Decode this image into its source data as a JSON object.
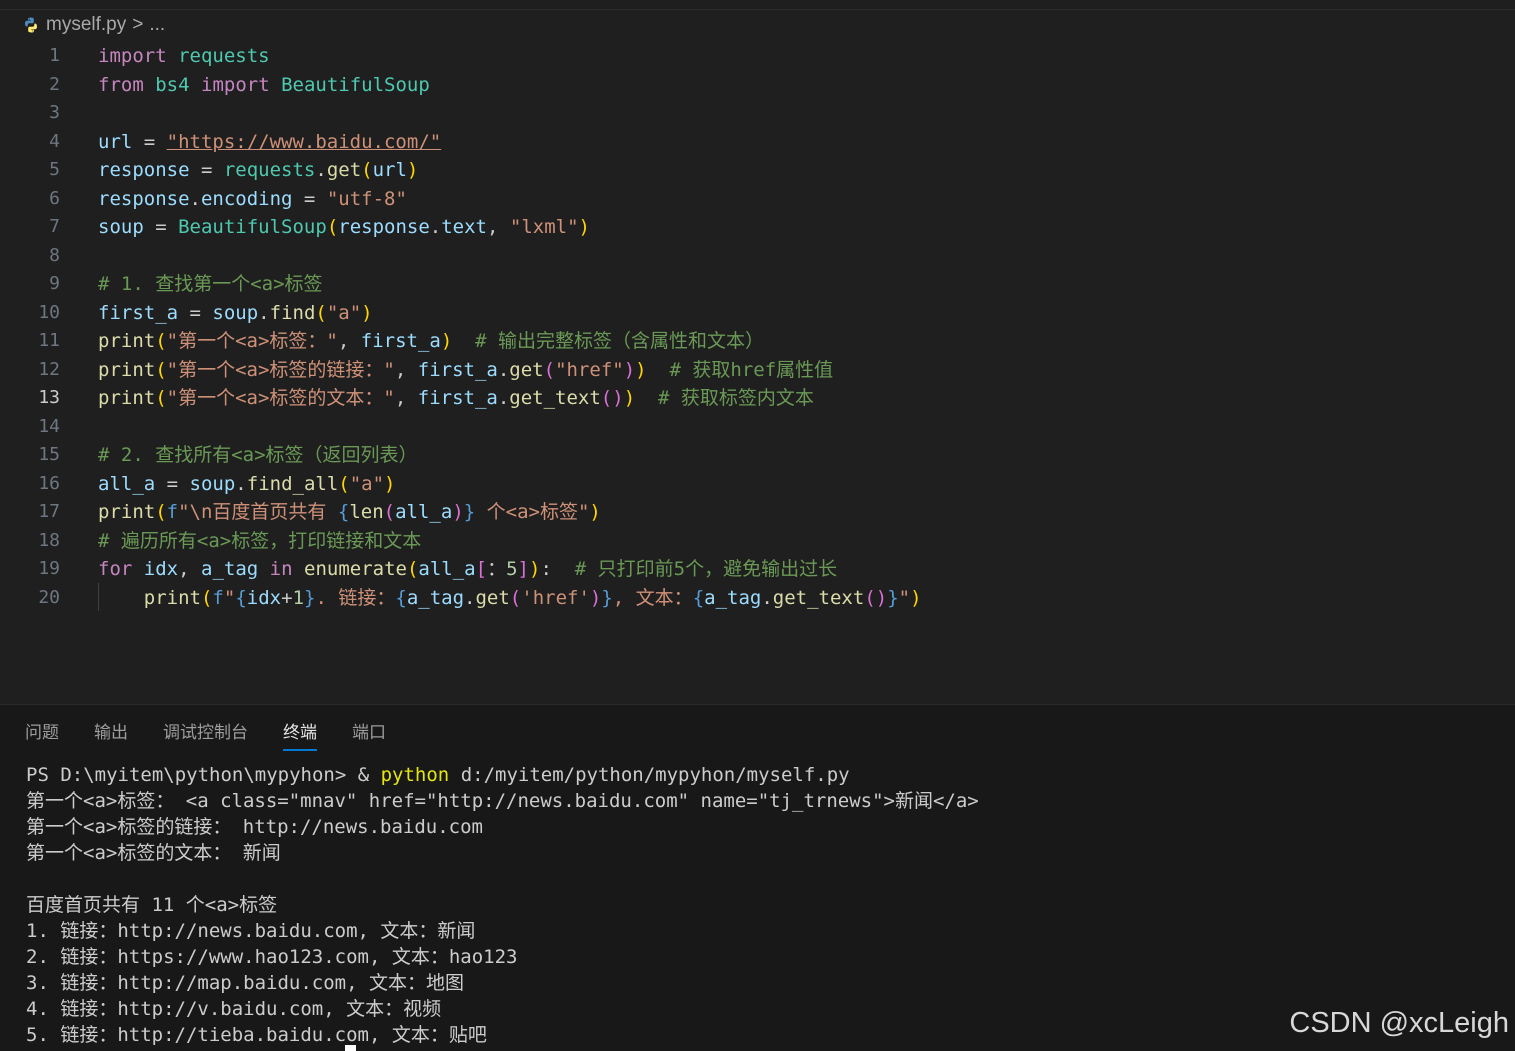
{
  "breadcrumb": {
    "file": "myself.py",
    "separator": ">",
    "more": "..."
  },
  "code_lines": [
    {
      "n": "1",
      "tokens": [
        [
          "k",
          "import"
        ],
        [
          "",
          "",
          " "
        ],
        [
          "m",
          "requests"
        ]
      ]
    },
    {
      "n": "2",
      "tokens": [
        [
          "k",
          "from"
        ],
        [
          "",
          " "
        ],
        [
          "m",
          "bs4"
        ],
        [
          "",
          " "
        ],
        [
          "k",
          "import"
        ],
        [
          "",
          " "
        ],
        [
          "m",
          "BeautifulSoup"
        ]
      ]
    },
    {
      "n": "3",
      "tokens": []
    },
    {
      "n": "4",
      "tokens": [
        [
          "v",
          "url"
        ],
        [
          "",
          " = "
        ],
        [
          "s u",
          "\"https://www.baidu.com/\""
        ]
      ]
    },
    {
      "n": "5",
      "tokens": [
        [
          "v",
          "response"
        ],
        [
          "",
          " = "
        ],
        [
          "m",
          "requests"
        ],
        [
          "",
          "."
        ],
        [
          "f",
          "get"
        ],
        [
          "p",
          "("
        ],
        [
          "v",
          "url"
        ],
        [
          "p",
          ")"
        ]
      ]
    },
    {
      "n": "6",
      "tokens": [
        [
          "v",
          "response"
        ],
        [
          "",
          "."
        ],
        [
          "v",
          "encoding"
        ],
        [
          "",
          " = "
        ],
        [
          "s",
          "\"utf-8\""
        ]
      ]
    },
    {
      "n": "7",
      "tokens": [
        [
          "v",
          "soup"
        ],
        [
          "",
          " = "
        ],
        [
          "m",
          "BeautifulSoup"
        ],
        [
          "p",
          "("
        ],
        [
          "v",
          "response"
        ],
        [
          "",
          "."
        ],
        [
          "v",
          "text"
        ],
        [
          "",
          ", "
        ],
        [
          "s",
          "\"lxml\""
        ],
        [
          "p",
          ")"
        ]
      ]
    },
    {
      "n": "8",
      "tokens": []
    },
    {
      "n": "9",
      "tokens": [
        [
          "c",
          "# 1. 查找第一个<a>标签"
        ]
      ]
    },
    {
      "n": "10",
      "tokens": [
        [
          "v",
          "first_a"
        ],
        [
          "",
          " = "
        ],
        [
          "v",
          "soup"
        ],
        [
          "",
          "."
        ],
        [
          "f",
          "find"
        ],
        [
          "p",
          "("
        ],
        [
          "s",
          "\"a\""
        ],
        [
          "p",
          ")"
        ]
      ]
    },
    {
      "n": "11",
      "tokens": [
        [
          "f",
          "print"
        ],
        [
          "p",
          "("
        ],
        [
          "s",
          "\"第一个<a>标签：\""
        ],
        [
          "",
          ", "
        ],
        [
          "v",
          "first_a"
        ],
        [
          "p",
          ")"
        ],
        [
          "",
          "  "
        ],
        [
          "c",
          "# 输出完整标签（含属性和文本）"
        ]
      ]
    },
    {
      "n": "12",
      "tokens": [
        [
          "f",
          "print"
        ],
        [
          "p",
          "("
        ],
        [
          "s",
          "\"第一个<a>标签的链接：\""
        ],
        [
          "",
          ", "
        ],
        [
          "v",
          "first_a"
        ],
        [
          "",
          "."
        ],
        [
          "f",
          "get"
        ],
        [
          "p2",
          "("
        ],
        [
          "s",
          "\"href\""
        ],
        [
          "p2",
          ")"
        ],
        [
          "p",
          ")"
        ],
        [
          "",
          "  "
        ],
        [
          "c",
          "# 获取href属性值"
        ]
      ]
    },
    {
      "n": "13",
      "active": true,
      "tokens": [
        [
          "f",
          "print"
        ],
        [
          "p",
          "("
        ],
        [
          "s",
          "\"第一个<a>标签的文本：\""
        ],
        [
          "",
          ", "
        ],
        [
          "v",
          "first_a"
        ],
        [
          "",
          "."
        ],
        [
          "f",
          "get_text"
        ],
        [
          "p2",
          "()"
        ],
        [
          "p",
          ")"
        ],
        [
          "",
          "  "
        ],
        [
          "c",
          "# 获取标签内文本"
        ]
      ]
    },
    {
      "n": "14",
      "tokens": []
    },
    {
      "n": "15",
      "tokens": [
        [
          "c",
          "# 2. 查找所有<a>标签（返回列表）"
        ]
      ]
    },
    {
      "n": "16",
      "tokens": [
        [
          "v",
          "all_a"
        ],
        [
          "",
          " = "
        ],
        [
          "v",
          "soup"
        ],
        [
          "",
          "."
        ],
        [
          "f",
          "find_all"
        ],
        [
          "p",
          "("
        ],
        [
          "s",
          "\"a\""
        ],
        [
          "p",
          ")"
        ]
      ]
    },
    {
      "n": "17",
      "tokens": [
        [
          "f",
          "print"
        ],
        [
          "p",
          "("
        ],
        [
          "kb",
          "f"
        ],
        [
          "s",
          "\"\\n百度首页共有 "
        ],
        [
          "kb",
          "{"
        ],
        [
          "f",
          "len"
        ],
        [
          "p2",
          "("
        ],
        [
          "v",
          "all_a"
        ],
        [
          "p2",
          ")"
        ],
        [
          "kb",
          "}"
        ],
        [
          "s",
          " 个<a>标签\""
        ],
        [
          "p",
          ")"
        ]
      ]
    },
    {
      "n": "18",
      "tokens": [
        [
          "c",
          "# 遍历所有<a>标签，打印链接和文本"
        ]
      ]
    },
    {
      "n": "19",
      "tokens": [
        [
          "k",
          "for"
        ],
        [
          "",
          " "
        ],
        [
          "v",
          "idx"
        ],
        [
          "",
          ", "
        ],
        [
          "v",
          "a_tag"
        ],
        [
          "",
          " "
        ],
        [
          "k",
          "in"
        ],
        [
          "",
          " "
        ],
        [
          "f",
          "enumerate"
        ],
        [
          "p",
          "("
        ],
        [
          "v",
          "all_a"
        ],
        [
          "p2",
          "["
        ],
        [
          "",
          "："
        ],
        [
          "n",
          "5"
        ],
        [
          "p2",
          "]"
        ],
        [
          "p",
          ")"
        ],
        [
          "",
          ":"
        ],
        [
          "",
          "  "
        ],
        [
          "c",
          "# 只打印前5个，避免输出过长"
        ]
      ]
    },
    {
      "n": "20",
      "tokens": [
        [
          "",
          "    "
        ],
        [
          "f",
          "print"
        ],
        [
          "p",
          "("
        ],
        [
          "kb",
          "f"
        ],
        [
          "s",
          "\""
        ],
        [
          "kb",
          "{"
        ],
        [
          "v",
          "idx"
        ],
        [
          "",
          "+"
        ],
        [
          "n",
          "1"
        ],
        [
          "kb",
          "}"
        ],
        [
          "s",
          ". 链接："
        ],
        [
          "kb",
          "{"
        ],
        [
          "v",
          "a_tag"
        ],
        [
          "",
          "."
        ],
        [
          "f",
          "get"
        ],
        [
          "p2",
          "("
        ],
        [
          "s",
          "'href'"
        ],
        [
          "p2",
          ")"
        ],
        [
          "kb",
          "}"
        ],
        [
          "s",
          ", 文本："
        ],
        [
          "kb",
          "{"
        ],
        [
          "v",
          "a_tag"
        ],
        [
          "",
          "."
        ],
        [
          "f",
          "get_text"
        ],
        [
          "p2",
          "()"
        ],
        [
          "kb",
          "}"
        ],
        [
          "s",
          "\""
        ],
        [
          "p",
          ")"
        ]
      ]
    }
  ],
  "panel": {
    "tabs": [
      {
        "label": "问题",
        "active": false
      },
      {
        "label": "输出",
        "active": false
      },
      {
        "label": "调试控制台",
        "active": false
      },
      {
        "label": "终端",
        "active": true
      },
      {
        "label": "端口",
        "active": false
      }
    ],
    "terminal": {
      "prompt": "PS D:\\myitem\\python\\mypyhon> & ",
      "command": "python",
      "command_arg": " d:/myitem/python/mypyhon/myself.py",
      "output": [
        "第一个<a>标签： <a class=\"mnav\" href=\"http://news.baidu.com\" name=\"tj_trnews\">新闻</a>",
        "第一个<a>标签的链接： http://news.baidu.com",
        "第一个<a>标签的文本： 新闻",
        "",
        "百度首页共有 11 个<a>标签",
        "1. 链接：http://news.baidu.com, 文本：新闻",
        "2. 链接：https://www.hao123.com, 文本：hao123",
        "3. 链接：http://map.baidu.com, 文本：地图",
        "4. 链接：http://v.baidu.com, 文本：视频",
        "5. 链接：http://tieba.baidu.com, 文本：贴吧"
      ]
    }
  },
  "watermark": "CSDN @xcLeigh",
  "colors": {
    "editor_bg": "#1f1f1f",
    "panel_bg": "#181818",
    "accent": "#0078d4"
  }
}
